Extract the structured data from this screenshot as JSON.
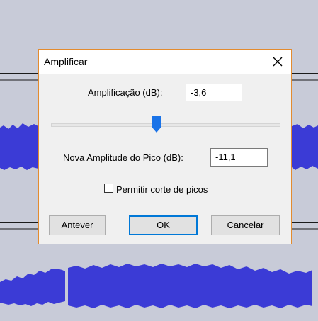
{
  "dialog": {
    "title": "Amplificar",
    "close_icon": "close-icon",
    "amplification_label": "Amplificação (dB):",
    "amplification_value": "-3,6",
    "slider_level": 0.46,
    "peak_label": "Nova Amplitude do Pico (dB):",
    "peak_value": "-11,1",
    "clip_label": "Permitir corte de picos",
    "clip_checked": false,
    "buttons": {
      "preview": "Antever",
      "ok": "OK",
      "cancel": "Cancelar"
    }
  },
  "colors": {
    "waveform": "#3b3bd6",
    "track_background": "#c8cbd8",
    "dialog_border": "#e38b2f",
    "slider_thumb": "#1a73e8",
    "default_button_border": "#0078d7"
  }
}
